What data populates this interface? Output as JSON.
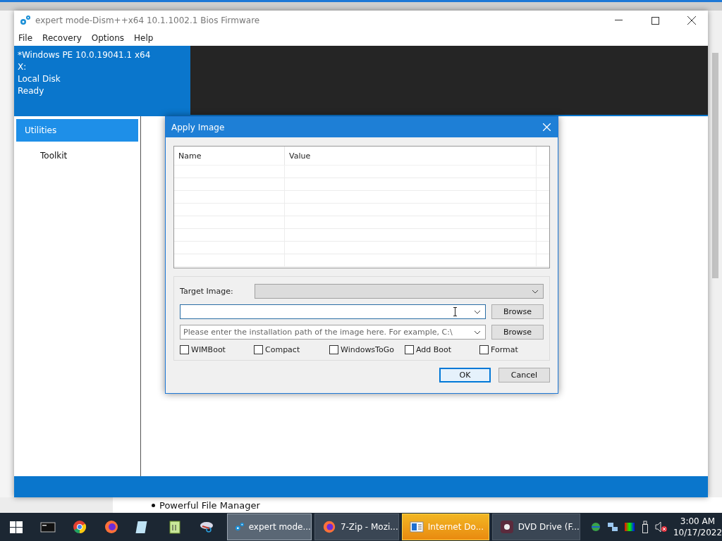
{
  "window": {
    "title": "expert mode-Dism++x64 10.1.1002.1 Bios Firmware"
  },
  "menu": [
    "File",
    "Recovery",
    "Options",
    "Help"
  ],
  "header": {
    "lines": [
      "*Windows PE 10.0.19041.1 x64",
      "X:",
      "Local Disk",
      "Ready"
    ]
  },
  "sidebar": {
    "items": [
      {
        "label": "Utilities",
        "selected": true,
        "children": [
          {
            "label": "Toolkit",
            "selected": false
          }
        ]
      }
    ]
  },
  "dialog": {
    "title": "Apply Image",
    "table": {
      "columns": [
        "Name",
        "Value"
      ]
    },
    "target_image": {
      "label": "Target Image:"
    },
    "source_field": {
      "button": "Browse"
    },
    "path_field": {
      "placeholder": "Please enter the installation path of the image here. For example, C:\\",
      "button": "Browse"
    },
    "options": [
      {
        "label": "WIMBoot",
        "checked": false
      },
      {
        "label": "Compact",
        "checked": false
      },
      {
        "label": "WindowsToGo",
        "checked": false
      },
      {
        "label": "Add Boot",
        "checked": false
      },
      {
        "label": "Format",
        "checked": false
      }
    ],
    "buttons": [
      {
        "label": "OK",
        "selected": true
      },
      {
        "label": "Cancel",
        "selected": false
      }
    ]
  },
  "background_page": {
    "bullet": "Powerful File Manager"
  },
  "taskbar": {
    "tasks": [
      {
        "label": "expert mode...",
        "kind": "gears",
        "selected": true,
        "attention": false
      },
      {
        "label": "7-Zip - Mozi...",
        "kind": "firefox",
        "selected": false,
        "attention": false
      },
      {
        "label": "Internet Do...",
        "kind": "window",
        "selected": false,
        "attention": true
      },
      {
        "label": "DVD Drive (F...",
        "kind": "disc",
        "selected": false,
        "attention": false
      }
    ],
    "clock": {
      "time": "3:00 AM",
      "date": "10/17/2022"
    }
  }
}
